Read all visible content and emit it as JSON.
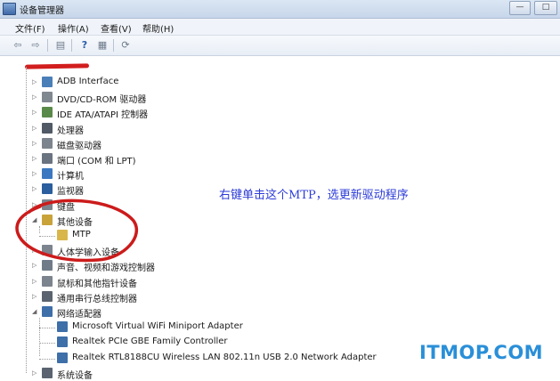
{
  "window": {
    "title": "设备管理器",
    "minimize_glyph": "—",
    "maximize_glyph": "□"
  },
  "menu": [
    "文件(F)",
    "操作(A)",
    "查看(V)",
    "帮助(H)"
  ],
  "toolbar": {
    "back_glyph": "⇦",
    "forward_glyph": "⇨",
    "view_glyph": "▤",
    "help_glyph": "?",
    "props_glyph": "▦",
    "scan_glyph": "⟳"
  },
  "tree": [
    {
      "label": "ADB Interface",
      "level": 1,
      "icon": "adb-device-icon",
      "color": "#4a7fb8",
      "expander": "▷"
    },
    {
      "label": "DVD/CD-ROM 驱动器",
      "level": 1,
      "icon": "dvd-drive-icon",
      "color": "#808890",
      "expander": "▷"
    },
    {
      "label": "IDE ATA/ATAPI 控制器",
      "level": 1,
      "icon": "ide-controller-icon",
      "color": "#5a8a4a",
      "expander": "▷"
    },
    {
      "label": "处理器",
      "level": 1,
      "icon": "processor-icon",
      "color": "#505a66",
      "expander": "▷"
    },
    {
      "label": "磁盘驱动器",
      "level": 1,
      "icon": "disk-drive-icon",
      "color": "#7c848e",
      "expander": "▷"
    },
    {
      "label": "端口 (COM 和 LPT)",
      "level": 1,
      "icon": "port-icon",
      "color": "#6a7380",
      "expander": "▷"
    },
    {
      "label": "计算机",
      "level": 1,
      "icon": "computer-icon",
      "color": "#3c78c0",
      "expander": "▷"
    },
    {
      "label": "监视器",
      "level": 1,
      "icon": "monitor-icon",
      "color": "#2a5e9e",
      "expander": "▷"
    },
    {
      "label": "键盘",
      "level": 1,
      "icon": "keyboard-icon",
      "color": "#7c848e",
      "expander": "▷"
    },
    {
      "label": "其他设备",
      "level": 1,
      "icon": "other-devices-icon",
      "color": "#c9a23a",
      "expander": "◢"
    },
    {
      "label": "MTP",
      "level": 2,
      "icon": "unknown-device-warning-icon",
      "color": "#d9b64a",
      "expander": ""
    },
    {
      "label": "人体学输入设备",
      "level": 1,
      "icon": "hid-icon",
      "color": "#7c848e",
      "expander": "▷"
    },
    {
      "label": "声音、视频和游戏控制器",
      "level": 1,
      "icon": "sound-icon",
      "color": "#6f7b88",
      "expander": "▷"
    },
    {
      "label": "鼠标和其他指针设备",
      "level": 1,
      "icon": "mouse-icon",
      "color": "#7c848e",
      "expander": "▷"
    },
    {
      "label": "通用串行总线控制器",
      "level": 1,
      "icon": "usb-icon",
      "color": "#5a6470",
      "expander": "▷"
    },
    {
      "label": "网络适配器",
      "level": 1,
      "icon": "network-adapter-icon",
      "color": "#3e6fa8",
      "expander": "◢"
    },
    {
      "label": "Microsoft Virtual WiFi Miniport Adapter",
      "level": 2,
      "icon": "network-card-icon",
      "color": "#3e6fa8",
      "expander": ""
    },
    {
      "label": "Realtek PCIe GBE Family Controller",
      "level": 2,
      "icon": "network-card-icon",
      "color": "#3e6fa8",
      "expander": ""
    },
    {
      "label": "Realtek RTL8188CU Wireless LAN 802.11n USB 2.0 Network Adapter",
      "level": 2,
      "icon": "network-card-icon",
      "color": "#3e6fa8",
      "expander": ""
    },
    {
      "label": "系统设备",
      "level": 1,
      "icon": "system-devices-icon",
      "color": "#5a6470",
      "expander": "▷"
    }
  ],
  "annotation": "右键单击这个MTP，选更新驱动程序",
  "watermark": "ITMOP.COM",
  "colors": {
    "annotation": "#2b3bd8",
    "circle": "#cc1b1b",
    "watermark": "#2a8fd8"
  }
}
